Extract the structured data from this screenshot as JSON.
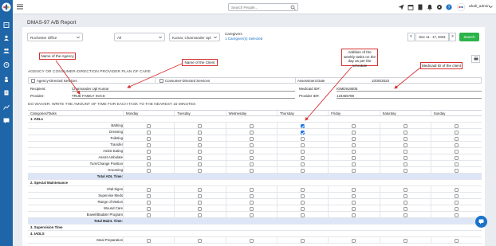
{
  "topbar": {
    "search_placeholder": "Search People...",
    "user_name": "ahali_admin",
    "icons": [
      "send-icon",
      "calendar-icon",
      "document-icon",
      "bell-icon",
      "gear-icon",
      "help-icon"
    ]
  },
  "sidebar": {
    "icons": [
      "clipboard-icon",
      "user-icon",
      "users-icon",
      "clock-icon",
      "person-icon",
      "document-icon",
      "reports-icon",
      "chart-icon",
      "message-icon"
    ]
  },
  "page": {
    "title": "DMAS-97 A/B Report"
  },
  "filters": {
    "office": "Rochester Office",
    "all": "All",
    "caregiver_select": "Kumar, Charmander Upl",
    "caregivers_label": "Caregivers",
    "caregivers_selected": "1 Caregiver(s) Selected",
    "date_range": "Dec 11 - 17, 2023",
    "prev": "<",
    "next": ">",
    "search_button": "Search"
  },
  "annotations": {
    "agency": "Name of the Agency",
    "client": "Name of the Client",
    "weekly_tasks": "Addition of the weekly tasks on the day as per the schedule",
    "medicaid": "Medicaid ID of the client"
  },
  "form": {
    "section_heading": "AGENCY OR CONSUMER-DIRECTION PROVIDER PLAN OF CARE",
    "agency_directed": "Agency-Directed Services",
    "consumer_directed": "Consumer-Directed Services",
    "assessment_date_label": "Assessment Date",
    "assessment_date_value": "10/30/2023",
    "recipient_label": "Recipient:",
    "recipient_value": "Charmander Upl Kumar",
    "medicaid_label": "Medicaid ID#:",
    "medicaid_value": "IGMD91800E",
    "provider_label": "Provider:",
    "provider_value": "TRUE FAMILY SVCS",
    "provider_id_label": "Provider ID#:",
    "provider_id_value": "123456789"
  },
  "task_table": {
    "heading": "DO WAIVER: WRITE THE AMOUNT OF TIME FOR EACH TASK TO THE NEAREST 15 MINUTES",
    "categories_header": "Categories/Tasks",
    "days": [
      "Monday",
      "Tuesday",
      "Wednesday",
      "Thursday",
      "Friday",
      "Saturday",
      "Sunday"
    ],
    "rows": [
      {
        "label": "1. ADLs",
        "kind": "cat"
      },
      {
        "label": "Bathing",
        "kind": "task",
        "checked": [
          false,
          false,
          false,
          true,
          false,
          false,
          false
        ]
      },
      {
        "label": "Dressing",
        "kind": "task",
        "checked": [
          false,
          false,
          false,
          true,
          false,
          false,
          false
        ]
      },
      {
        "label": "Toileting",
        "kind": "task",
        "checked": [
          false,
          false,
          false,
          false,
          false,
          false,
          false
        ]
      },
      {
        "label": "Transfer",
        "kind": "task",
        "checked": [
          false,
          false,
          false,
          false,
          false,
          false,
          false
        ]
      },
      {
        "label": "Assist Eating",
        "kind": "task",
        "checked": [
          false,
          false,
          false,
          false,
          false,
          false,
          false
        ]
      },
      {
        "label": "Assist Ambulate",
        "kind": "task",
        "checked": [
          false,
          false,
          false,
          false,
          false,
          false,
          false
        ]
      },
      {
        "label": "Turn/Change Position",
        "kind": "task",
        "checked": [
          false,
          false,
          false,
          false,
          false,
          false,
          false
        ]
      },
      {
        "label": "Grooming",
        "kind": "task",
        "checked": [
          false,
          false,
          false,
          false,
          false,
          false,
          false
        ]
      },
      {
        "label": "Total ADL Time:",
        "kind": "total"
      },
      {
        "label": "2. Special Maintenance",
        "kind": "cat"
      },
      {
        "label": "Vital Signs",
        "kind": "task",
        "checked": [
          false,
          false,
          false,
          false,
          false,
          false,
          false
        ]
      },
      {
        "label": "Supervise Meds",
        "kind": "task",
        "checked": [
          false,
          false,
          false,
          false,
          false,
          false,
          false
        ]
      },
      {
        "label": "Range of Motion",
        "kind": "task",
        "checked": [
          false,
          false,
          false,
          false,
          false,
          false,
          false
        ]
      },
      {
        "label": "Wound Care",
        "kind": "task",
        "checked": [
          false,
          false,
          false,
          false,
          false,
          false,
          false
        ]
      },
      {
        "label": "Bowel/Bladder Program",
        "kind": "task",
        "checked": [
          false,
          false,
          false,
          false,
          false,
          false,
          false
        ]
      },
      {
        "label": "Total Maint. Time:",
        "kind": "total"
      },
      {
        "label": "3. Supervision Time",
        "kind": "cat"
      },
      {
        "label": "4. IADLS",
        "kind": "cat"
      },
      {
        "label": "Meal Preparation",
        "kind": "task",
        "checked": [
          false,
          false,
          false,
          false,
          false,
          false,
          false
        ]
      }
    ]
  },
  "colors": {
    "sidebar": "#1f66a8",
    "accent": "#1a73e8",
    "search_button": "#2cb34a",
    "annotation": "#d62f2f",
    "total_row": "#dde6f7"
  }
}
